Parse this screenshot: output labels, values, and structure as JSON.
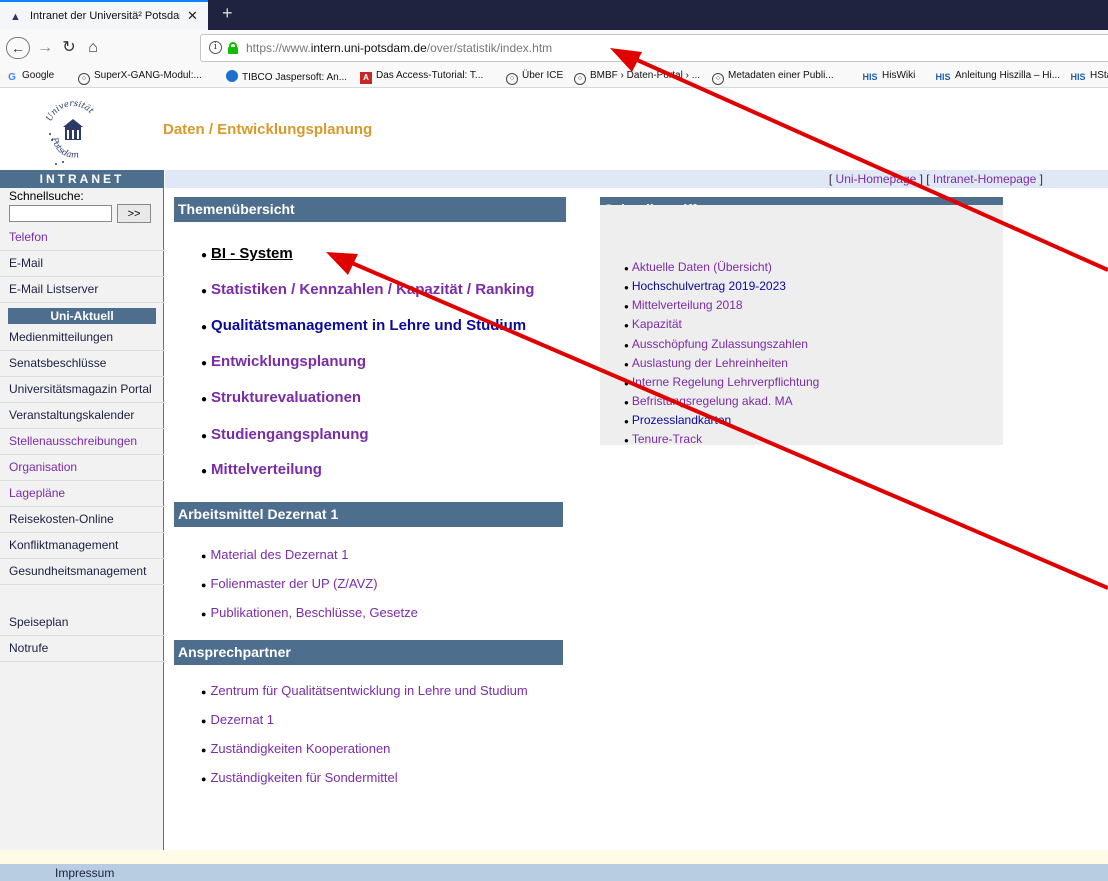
{
  "browser": {
    "tab_title": "Intranet der Universitä² Potsdam",
    "tab_close": "✕",
    "new_tab": "+",
    "url_scheme": "https://www.",
    "url_host": "intern.uni-potsdam.de",
    "url_path": "/over/statistik/index.htm",
    "bookmarks": [
      {
        "label": "Google",
        "icon": "google-icon"
      },
      {
        "label": "SuperX-GANG-Modul:...",
        "icon": "globe-icon"
      },
      {
        "label": "TIBCO Jaspersoft: An...",
        "icon": "tibco-icon"
      },
      {
        "label": "Das Access-Tutorial: T...",
        "icon": "access-icon"
      },
      {
        "label": "Über ICE",
        "icon": "globe-icon"
      },
      {
        "label": "BMBF › Daten-Portal › ...",
        "icon": "globe-icon"
      },
      {
        "label": "Metadaten einer Publi...",
        "icon": "globe-icon"
      },
      {
        "label": "HisWiki",
        "icon": "his-icon"
      },
      {
        "label": "Anleitung Hiszilla – Hi...",
        "icon": "his-icon"
      },
      {
        "label": "HStat",
        "icon": "his-icon"
      }
    ]
  },
  "header": {
    "logo_text_top": "Universität",
    "logo_text_bottom": "Potsdam",
    "title": "Daten / Entwicklungsplanung"
  },
  "sidebar": {
    "intranet_label": "INTRANET",
    "search_label": "Schnellsuche:",
    "search_button": ">>",
    "group1": [
      "Telefon",
      "E-Mail",
      "E-Mail Listserver"
    ],
    "uni_aktuell": "Uni-Aktuell",
    "group2": [
      "Medienmitteilungen",
      "Senatsbeschlüsse",
      "Universitätsmagazin Portal",
      "Veranstaltungskalender",
      "Stellenausschreibungen",
      "Organisation",
      "Lagepläne",
      "Reisekosten-Online",
      "Konfliktmanagement",
      "Gesundheitsmanagement"
    ],
    "group3": [
      "Speiseplan",
      "Notrufe"
    ]
  },
  "topbar": {
    "link1": "Uni-Homepage",
    "link2": "Intranet-Homepage"
  },
  "themen": {
    "heading": "Themenübersicht",
    "links": [
      "BI - System",
      "Statistiken / Kennzahlen / Kapazität / Ranking",
      "Qualitätsmanagement in Lehre und Studium",
      "Entwicklungsplanung",
      "Strukturevaluationen",
      "Studiengangsplanung",
      "Mittelverteilung"
    ]
  },
  "arbeitsmittel": {
    "heading": "Arbeitsmittel Dezernat 1",
    "links": [
      "Material des Dezernat 1",
      "Folienmaster der UP (Z/AVZ)",
      "Publikationen, Beschlüsse, Gesetze"
    ]
  },
  "ansprechpartner": {
    "heading": "Ansprechpartner",
    "links": [
      "Zentrum für Qualitätsentwicklung in Lehre und Studium",
      "Dezernat 1",
      "Zuständigkeiten Kooperationen",
      "Zuständigkeiten für Sondermittel"
    ]
  },
  "schnellzugriff": {
    "heading": "Schnellzugriff",
    "links": [
      "Aktuelle Daten (Übersicht)",
      "Hochschulvertrag 2019-2023",
      "Mittelverteilung 2018",
      "Kapazität",
      "Ausschöpfung Zulassungszahlen",
      "Auslastung der Lehreinheiten",
      "Interne Regelung Lehrverpflichtung",
      "Befristungsregelung akad. MA",
      "Prozesslandkarten",
      "Tenure-Track"
    ]
  },
  "footer": {
    "impressum": "Impressum"
  },
  "colors": {
    "section_header": "#4e6e8e",
    "visited_link": "#7b2ca8",
    "link": "#0a0a9e",
    "title_orange": "#d79a2b",
    "annotation_arrow": "#e00000"
  }
}
